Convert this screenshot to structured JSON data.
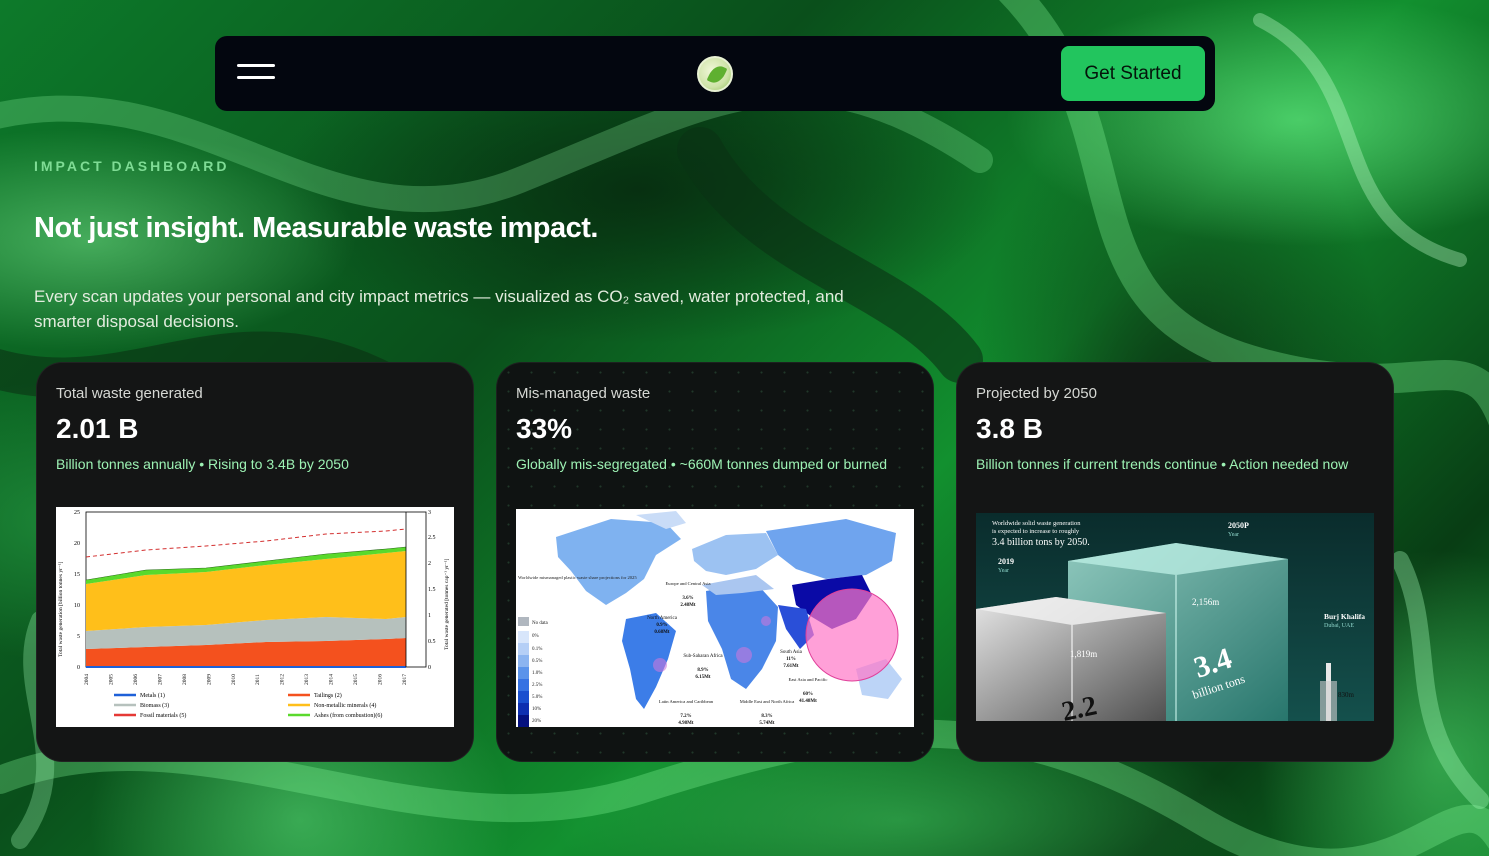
{
  "nav": {
    "menu_icon": "hamburger-menu-icon",
    "logo_icon": "leaf-logo-icon",
    "cta_label": "Get Started"
  },
  "hero": {
    "eyebrow": "IMPACT DASHBOARD",
    "headline": "Not just insight. Measurable waste impact.",
    "subtitle": "Every scan updates your personal and city impact metrics — visualized as CO₂ saved, water protected, and smarter disposal decisions."
  },
  "colors": {
    "accent": "#22c55e",
    "eyebrow": "#7fdc95",
    "card_desc": "#9df2b4",
    "nav_bg": "#03060f"
  },
  "cards": [
    {
      "label": "Total waste generated",
      "value": "2.01 B",
      "description": "Billion tonnes annually • Rising to 3.4B by 2050"
    },
    {
      "label": "Mis-managed waste",
      "value": "33%",
      "description": "Globally mis-segregated • ~660M tonnes dumped or burned"
    },
    {
      "label": "Projected by 2050",
      "value": "3.8 B",
      "description": "Billion tonnes if current trends continue • Action needed now"
    }
  ],
  "chart1": {
    "y_left_label": "Total waste generation [billion tonnes yr⁻¹]",
    "y_right_label": "Total waste generated [tonnes cap⁻¹ yr⁻¹]",
    "y_left_ticks": [
      "0",
      "5",
      "10",
      "15",
      "20",
      "25"
    ],
    "y_right_ticks": [
      "0",
      "0.5",
      "1",
      "1.5",
      "2",
      "2.5",
      "3"
    ],
    "years": [
      "2004",
      "2005",
      "2006",
      "2007",
      "2008",
      "2009",
      "2010",
      "2011",
      "2012",
      "2013",
      "2014",
      "2015",
      "2016",
      "2017"
    ],
    "legend": [
      "Metals (1)",
      "Tailings (2)",
      "Biomass (3)",
      "Non-metallic minerals (4)",
      "Fossil materials (5)",
      "Ashes (from combustion)(6)"
    ]
  },
  "chart2": {
    "legend_title": "Worldwide mismanaged plastic waste share projections for 2025",
    "legend_items": [
      "No data",
      "0%",
      "0.1%",
      "0.5%",
      "1.0%",
      "2.5%",
      "5.0%",
      "10%",
      "20%"
    ],
    "regions": [
      {
        "name": "North America",
        "pct": "0.9%",
        "mt": "0.68Mt"
      },
      {
        "name": "Europe and Central Asia",
        "pct": "3.6%",
        "mt": "2.48Mt"
      },
      {
        "name": "Sub-Saharan Africa",
        "pct": "8.9%",
        "mt": "6.15Mt"
      },
      {
        "name": "Latin America and Caribbean",
        "pct": "7.2%",
        "mt": "4.98Mt"
      },
      {
        "name": "Middle East and North Africa",
        "pct": "8.3%",
        "mt": "5.74Mt"
      },
      {
        "name": "South Asia",
        "pct": "11%",
        "mt": "7.61Mt"
      },
      {
        "name": "East Asia and Pacific",
        "pct": "60%",
        "mt": "41.48Mt"
      }
    ]
  },
  "chart3": {
    "caption_line1": "Worldwide solid waste generation",
    "caption_line2": "is expected to increase to roughly",
    "caption_line3": "3.4 billion tons by 2050.",
    "label_2019": "2019",
    "label_2050": "2050P",
    "year_word": "Year",
    "height_2019": "1,819m",
    "height_2050": "2,156m",
    "big_2050": "3.4",
    "big_2050_unit": "billion tons",
    "big_2019": "2.2",
    "landmark": "Burj Khalifa",
    "landmark_loc": "Dubai, UAE",
    "landmark_height": "830m"
  }
}
